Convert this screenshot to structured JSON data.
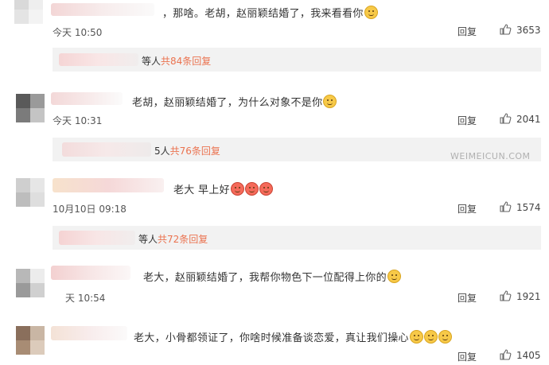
{
  "comments": [
    {
      "text": "，那啥。老胡，赵丽颖结婚了，我来看看你",
      "time": "今天 10:50",
      "reply": "回复",
      "likes": "3653",
      "sub": {
        "prefix": "等人",
        "count": "共84条回复"
      }
    },
    {
      "text": "老胡，赵丽颖结婚了，为什么对象不是你",
      "time": "今天 10:31",
      "reply": "回复",
      "likes": "2041",
      "sub": {
        "prefix": "5人",
        "count": "共76条回复"
      }
    },
    {
      "text": "老大 早上好",
      "time": "10月10日 09:18",
      "reply": "回复",
      "likes": "1574",
      "sub": {
        "prefix": "等人",
        "count": "共72条回复"
      }
    },
    {
      "text": "老大，赵丽颖结婚了，我帮你物色下一位配得上你的",
      "time": "天 10:54",
      "reply": "回复",
      "likes": "1921"
    },
    {
      "text": "老大，小骨都领证了，你啥时候准备谈恋爱，真让我们操心",
      "time": "",
      "reply": "回复",
      "likes": "1405"
    }
  ],
  "watermark": "WEIMEICUN.COM",
  "icons": {
    "like": "thumbs-up-icon",
    "emoji": "smile-emoji-icon"
  },
  "colors": {
    "reply_count": "#eb7350",
    "sub_bg": "#f2f2f2"
  }
}
